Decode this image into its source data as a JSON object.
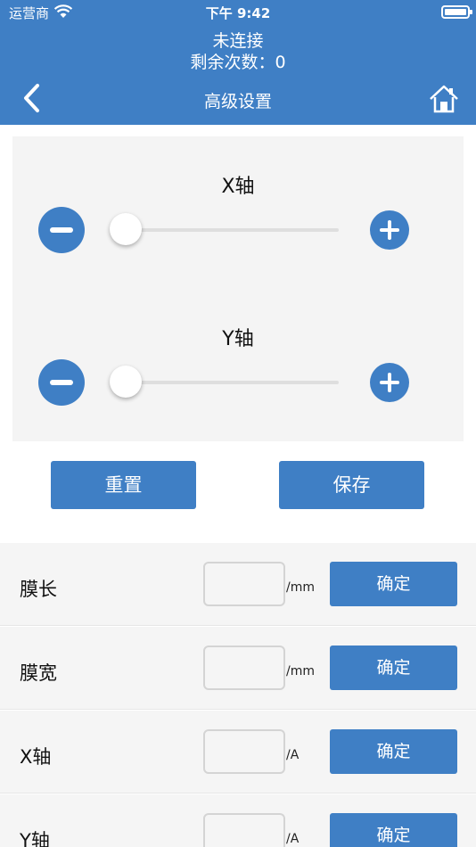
{
  "status_bar": {
    "carrier": "运营商",
    "time": "下午 9:42"
  },
  "header": {
    "connection": "未连接",
    "remaining": "剩余次数：0",
    "title": "高级设置"
  },
  "axes": [
    {
      "label": "X轴",
      "value": 0
    },
    {
      "label": "Y轴",
      "value": 0
    }
  ],
  "actions": {
    "reset": "重置",
    "save": "保存"
  },
  "settings": [
    {
      "label": "膜长",
      "value": "",
      "unit": "/mm",
      "button": "确定"
    },
    {
      "label": "膜宽",
      "value": "",
      "unit": "/mm",
      "button": "确定"
    },
    {
      "label": "X轴",
      "value": "",
      "unit": "/A",
      "button": "确定"
    },
    {
      "label": "Y轴",
      "value": "",
      "unit": "/A",
      "button": "确定"
    }
  ],
  "colors": {
    "primary": "#3f7fc5",
    "panel": "#f4f4f4",
    "row": "#f5f5f5"
  }
}
